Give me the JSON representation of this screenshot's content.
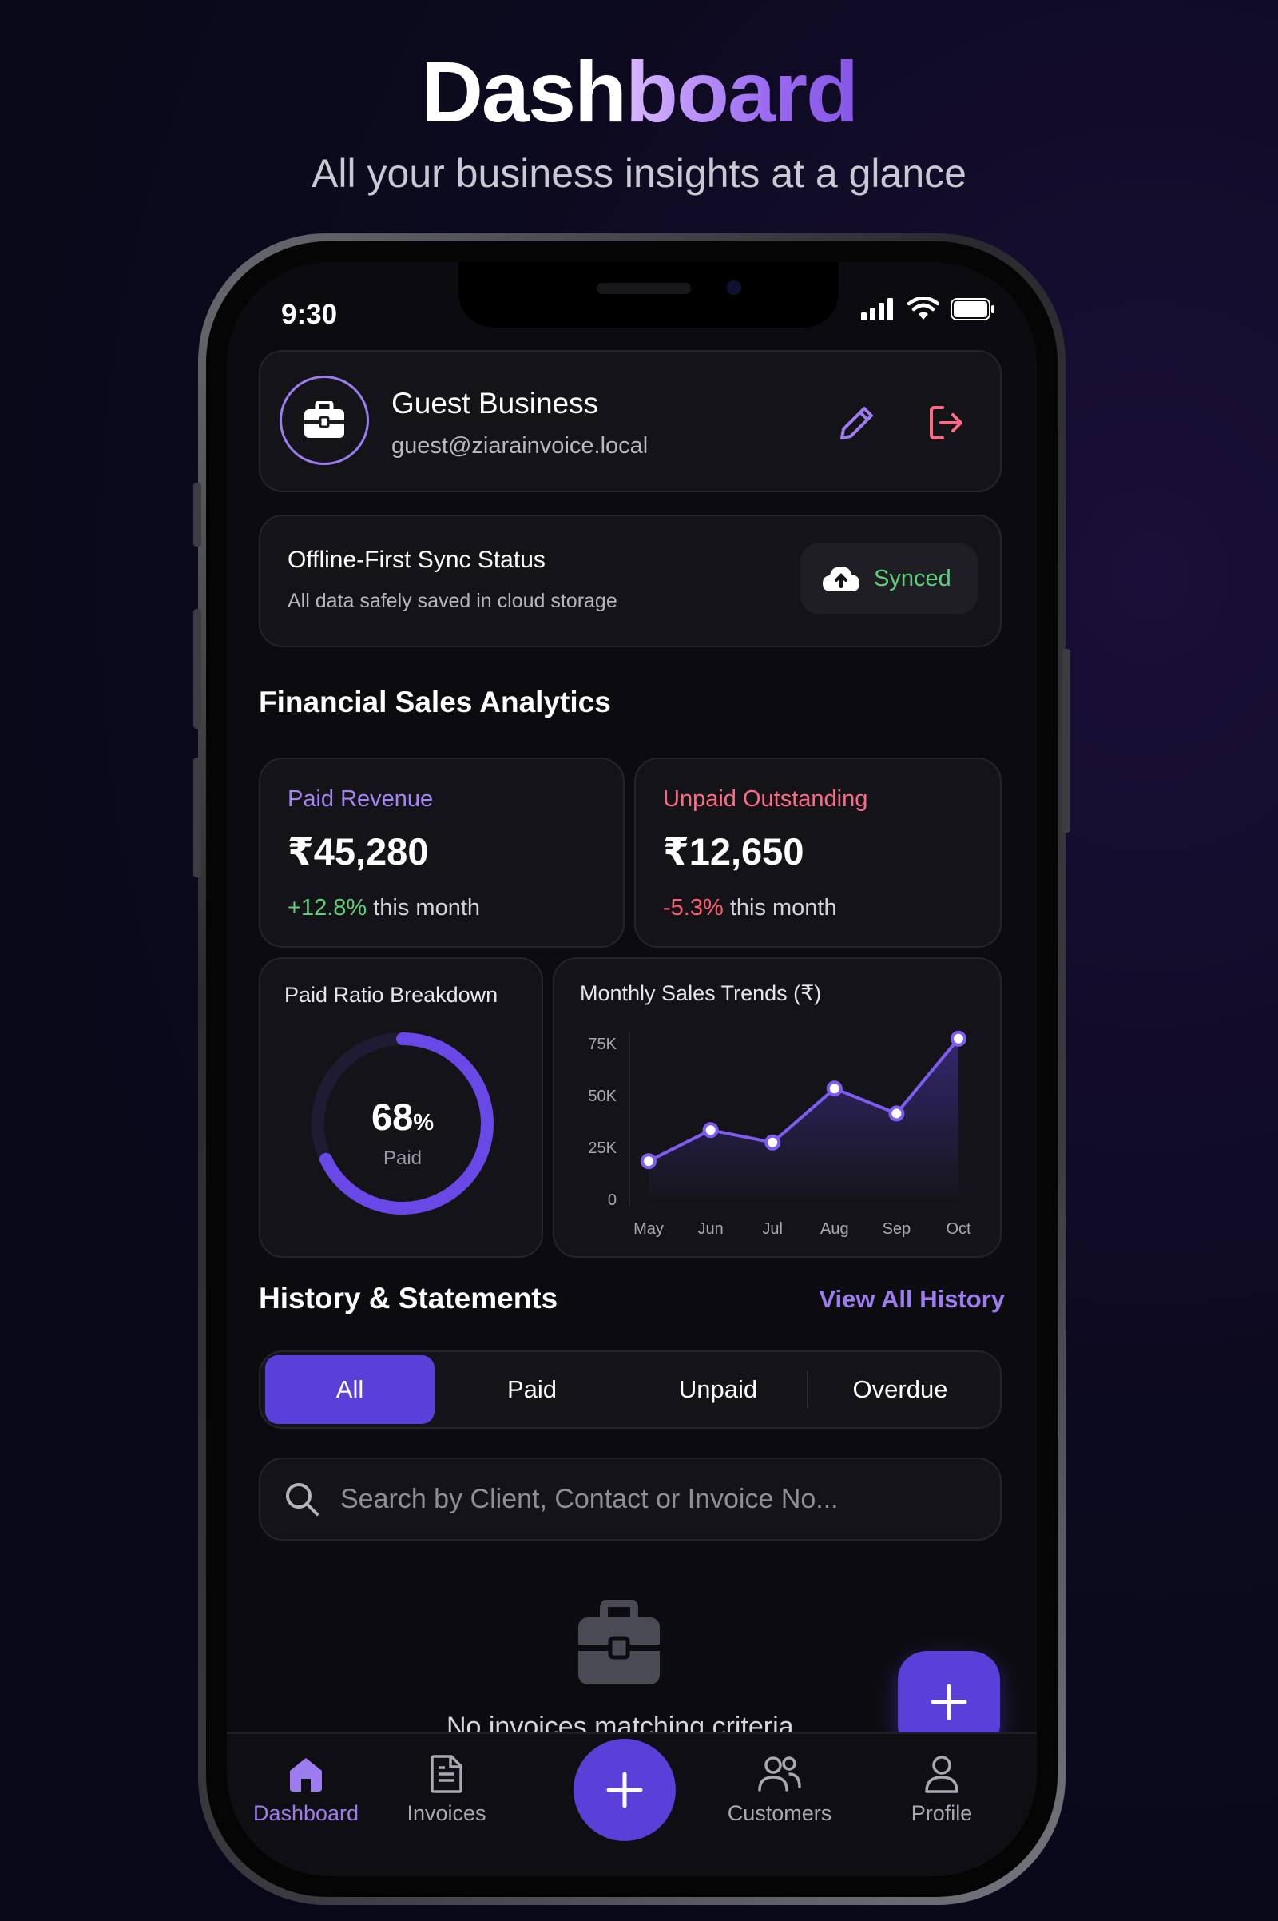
{
  "hero": {
    "title_part1": "Dash",
    "title_part2": "board",
    "subtitle": "All your business insights at a glance"
  },
  "status_bar": {
    "time": "9:30"
  },
  "profile": {
    "name": "Guest Business",
    "email": "guest@ziarainvoice.local"
  },
  "sync": {
    "title": "Offline-First Sync Status",
    "description": "All data safely saved in cloud storage",
    "status": "Synced"
  },
  "analytics": {
    "title": "Financial Sales Analytics",
    "paid": {
      "label": "Paid Revenue",
      "value": "₹45,280",
      "delta": "+12.8%",
      "period": "this month"
    },
    "unpaid": {
      "label": "Unpaid Outstanding",
      "value": "₹12,650",
      "delta": "-5.3%",
      "period": "this month"
    },
    "ratio": {
      "title": "Paid Ratio Breakdown",
      "value": "68",
      "unit": "%",
      "label": "Paid",
      "fraction": 0.68
    },
    "trend_title": "Monthly Sales Trends (₹)"
  },
  "chart_data": {
    "type": "line",
    "title": "Monthly Sales Trends (₹)",
    "categories": [
      "May",
      "Jun",
      "Jul",
      "Aug",
      "Sep",
      "Oct"
    ],
    "values": [
      18000,
      33000,
      27000,
      53000,
      41000,
      77000
    ],
    "yticks": [
      "0",
      "25K",
      "50K",
      "75K"
    ],
    "ylim": [
      0,
      80000
    ],
    "grid": false,
    "color": "#7f5cf0"
  },
  "history": {
    "title": "History & Statements",
    "view_all": "View All History",
    "tabs": [
      "All",
      "Paid",
      "Unpaid",
      "Overdue"
    ],
    "search_placeholder": "Search by Client, Contact or Invoice No...",
    "empty": "No invoices matching criteria."
  },
  "nav": {
    "dashboard": "Dashboard",
    "invoices": "Invoices",
    "customers": "Customers",
    "profile": "Profile"
  },
  "colors": {
    "accent": "#5b3fd9",
    "accent_light": "#9d7cf0",
    "positive": "#5fd07a",
    "negative": "#ff5a6e",
    "unpaid_label": "#ff6b86"
  }
}
